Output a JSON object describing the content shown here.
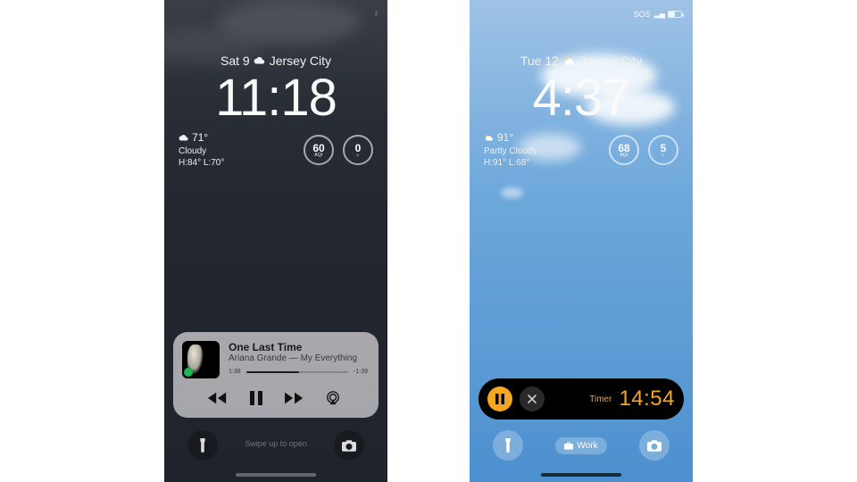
{
  "left": {
    "status": {
      "left_label": "",
      "right_label": ""
    },
    "date": "Sat 9",
    "weather_icon": "cloud-icon",
    "location": "Jersey City",
    "time": "11:18",
    "weather": {
      "temp": "71°",
      "condition": "Cloudy",
      "hi_lo": "H:84° L:70°"
    },
    "aqi": {
      "value": "60",
      "label": "AQI"
    },
    "uv": {
      "value": "0",
      "label": "☼"
    },
    "music": {
      "title": "One Last Time",
      "artist": "Ariana Grande — My Everything",
      "elapsed": "1:38",
      "remaining": "-1:39"
    },
    "swipe_hint": "Swipe up to open"
  },
  "right": {
    "status": {
      "sos": "SOS",
      "signal": "ıl",
      "battery_pct": 50
    },
    "date": "Tue 12",
    "weather_icon": "sun-cloud-icon",
    "location": "Jersey City",
    "time": "4:37",
    "weather": {
      "temp": "91°",
      "condition": "Partly Cloudy",
      "hi_lo": "H:91° L:68°"
    },
    "aqi": {
      "value": "68",
      "label": "AQI"
    },
    "uv": {
      "value": "5",
      "label": "☼"
    },
    "timer": {
      "label": "Timer",
      "value": "14:54"
    },
    "focus": {
      "label": "Work"
    }
  }
}
